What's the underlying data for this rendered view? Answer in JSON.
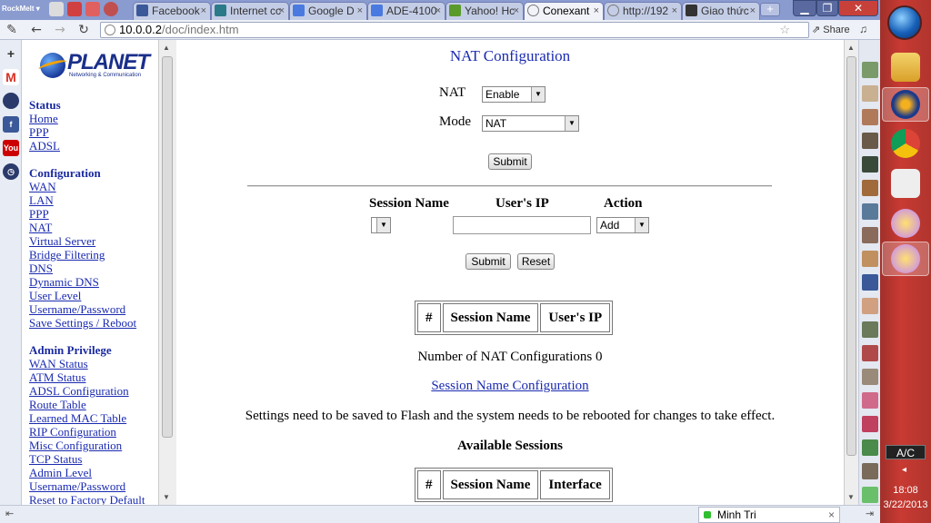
{
  "browser": {
    "brand": "RockMelt",
    "tabs": [
      {
        "label": "Facebook",
        "color": "#3b5998"
      },
      {
        "label": "Internet cc",
        "color": "#2a7a8a"
      },
      {
        "label": "Google D",
        "color": "#4a7adf"
      },
      {
        "label": "ADE-4100",
        "color": "#4a7adf"
      },
      {
        "label": "Yahoo! Hc",
        "color": "#5a9a2a"
      },
      {
        "label": "Conexant",
        "color": "#777777",
        "active": true
      },
      {
        "label": "http://192",
        "color": "#777777"
      },
      {
        "label": "Giao thức",
        "color": "#333333"
      }
    ],
    "url_host": "10.0.0.2",
    "url_path": "/doc/index.htm",
    "share_label": "Share"
  },
  "nav": {
    "sections": [
      {
        "heading": "Status",
        "links": [
          "Home",
          "PPP",
          "ADSL"
        ]
      },
      {
        "heading": "Configuration",
        "links": [
          "WAN",
          "LAN",
          "PPP",
          "NAT",
          "Virtual Server",
          "Bridge Filtering",
          "DNS",
          "Dynamic DNS",
          "User Level",
          "Username/Password",
          "Save Settings / Reboot"
        ]
      },
      {
        "heading": "Admin Privilege",
        "links": [
          "WAN Status",
          "ATM Status",
          "ADSL Configuration",
          "Route Table",
          "Learned MAC Table",
          "RIP Configuration",
          "Misc Configuration",
          "TCP Status",
          "Admin Level",
          "Username/Password",
          "Reset to Factory Default"
        ]
      }
    ],
    "logo_word": "PLANET",
    "logo_tag": "Networking & Communication"
  },
  "main": {
    "title": "NAT Configuration",
    "nat_label": "NAT",
    "nat_value": "Enable",
    "mode_label": "Mode",
    "mode_value": "NAT",
    "submit_label": "Submit",
    "session_name_header": "Session Name",
    "users_ip_header": "User's IP",
    "action_header": "Action",
    "action_value": "Add",
    "submit2_label": "Submit",
    "reset_label": "Reset",
    "table1_headers": [
      "#",
      "Session Name",
      "User's IP"
    ],
    "count_text": "Number of NAT Configurations 0",
    "session_link": "Session Name Configuration",
    "note": "Settings need to be saved to Flash and the system needs to be rebooted for changes to take effect.",
    "available_sessions": "Available Sessions",
    "table2_headers": [
      "#",
      "Session Name",
      "Interface"
    ]
  },
  "status": {
    "chat_name": "Minh Tri"
  },
  "taskbar": {
    "lang": "A/C",
    "time": "18:08",
    "date": "3/22/2013"
  }
}
